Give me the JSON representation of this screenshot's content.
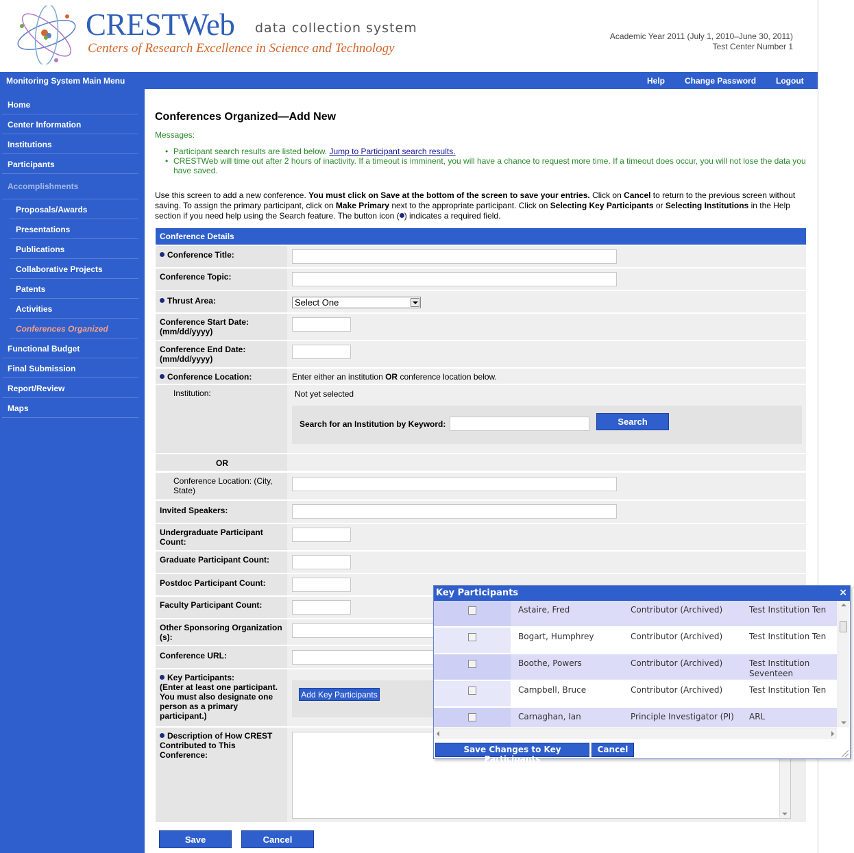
{
  "header": {
    "logo_title": "CRESTWeb",
    "logo_subtitle": "data collection system",
    "logo_tagline": "Centers of Research Excellence in Science and Technology",
    "academic_year": "Academic Year 2011 (July 1, 2010–June 30, 2011)",
    "center_name": "Test Center Number 1"
  },
  "topnav": {
    "title": "Monitoring System Main Menu",
    "help": "Help",
    "change_password": "Change Password",
    "logout": "Logout"
  },
  "sidebar": {
    "items": [
      {
        "label": "Home"
      },
      {
        "label": "Center Information"
      },
      {
        "label": "Institutions"
      },
      {
        "label": "Participants"
      },
      {
        "label": "Accomplishments"
      },
      {
        "label": "Proposals/Awards"
      },
      {
        "label": "Presentations"
      },
      {
        "label": "Publications"
      },
      {
        "label": "Collaborative Projects"
      },
      {
        "label": "Patents"
      },
      {
        "label": "Activities"
      },
      {
        "label": "Conferences Organized"
      },
      {
        "label": "Functional Budget"
      },
      {
        "label": "Final Submission"
      },
      {
        "label": "Report/Review"
      },
      {
        "label": "Maps"
      }
    ]
  },
  "page": {
    "title": "Conferences Organized—Add New",
    "messages_label": "Messages:",
    "message1_text": "Participant search results are listed below.",
    "message1_link": "Jump to Participant search results.",
    "message2": "CRESTWeb will time out after 2 hours of inactivity. If a timeout is imminent, you will have a chance to request more time. If a timeout does occur, you will not lose the data you have saved.",
    "instructions": {
      "p1": "Use this screen to add a new conference.",
      "b1": "You must click on",
      "b2": "Save",
      "b3": "at the bottom of the screen to save your entries.",
      "p2": "Click on",
      "b4": "Cancel",
      "p3": "to return to the previous screen without saving. To assign the primary participant, click on",
      "b5": "Make Primary",
      "p4": "next to the appropriate participant. Click on",
      "b6": "Selecting Key Participants",
      "p5": "or",
      "b7": "Selecting Institutions",
      "p6": "in the Help section if you need help using the Search feature. The button icon (",
      "p7": ") indicates a required field."
    }
  },
  "form": {
    "section_title": "Conference Details",
    "conference_title_label": "Conference Title:",
    "conference_topic_label": "Conference Topic:",
    "thrust_area_label": "Thrust Area:",
    "thrust_area_value": "Select One",
    "start_date_label": "Conference Start Date: (mm/dd/yyyy)",
    "end_date_label": "Conference End Date: (mm/dd/yyyy)",
    "location_label": "Conference Location:",
    "location_hint_a": "Enter either an institution",
    "location_hint_or": "OR",
    "location_hint_b": "conference location below.",
    "institution_label": "Institution:",
    "institution_value": "Not yet selected",
    "inst_search_label": "Search for an Institution by Keyword:",
    "inst_search_button": "Search",
    "or_label": "OR",
    "conf_location_label": "Conference Location: (City, State)",
    "invited_speakers_label": "Invited Speakers:",
    "undergrad_label": "Undergraduate Participant Count:",
    "grad_label": "Graduate Participant Count:",
    "postdoc_label": "Postdoc Participant Count:",
    "faculty_label": "Faculty Participant Count:",
    "sponsor_label": "Other Sponsoring Organization (s):",
    "url_label": "Conference URL:",
    "key_participants_label": "Key Participants:",
    "key_participants_note": "(Enter at least one participant. You must also designate one person as a primary participant.)",
    "add_key_participants_button": "Add Key Participants",
    "description_label": "Description of How CREST Contributed to This Conference:",
    "save_button": "Save",
    "cancel_button": "Cancel"
  },
  "popup": {
    "title": "Key Participants",
    "close": "×",
    "rows": [
      {
        "name": "Astaire, Fred",
        "role": "Contributor (Archived)",
        "institution": "Test Institution Ten"
      },
      {
        "name": "Bogart, Humphrey",
        "role": "Contributor (Archived)",
        "institution": "Test Institution Ten"
      },
      {
        "name": "Boothe, Powers",
        "role": "Contributor (Archived)",
        "institution": "Test Institution Seventeen"
      },
      {
        "name": "Campbell, Bruce",
        "role": "Contributor (Archived)",
        "institution": "Test Institution Ten"
      },
      {
        "name": "Carnaghan, Ian",
        "role": "Principle Investigator (PI)",
        "institution": "ARL"
      }
    ],
    "save_button": "Save Changes to Key Participants",
    "cancel_button": "Cancel"
  },
  "colors": {
    "nav_blue": "#2f5fcc",
    "message_green": "#2a8a2a",
    "active_item": "#f4a08a",
    "tagline_orange": "#d2662c"
  }
}
